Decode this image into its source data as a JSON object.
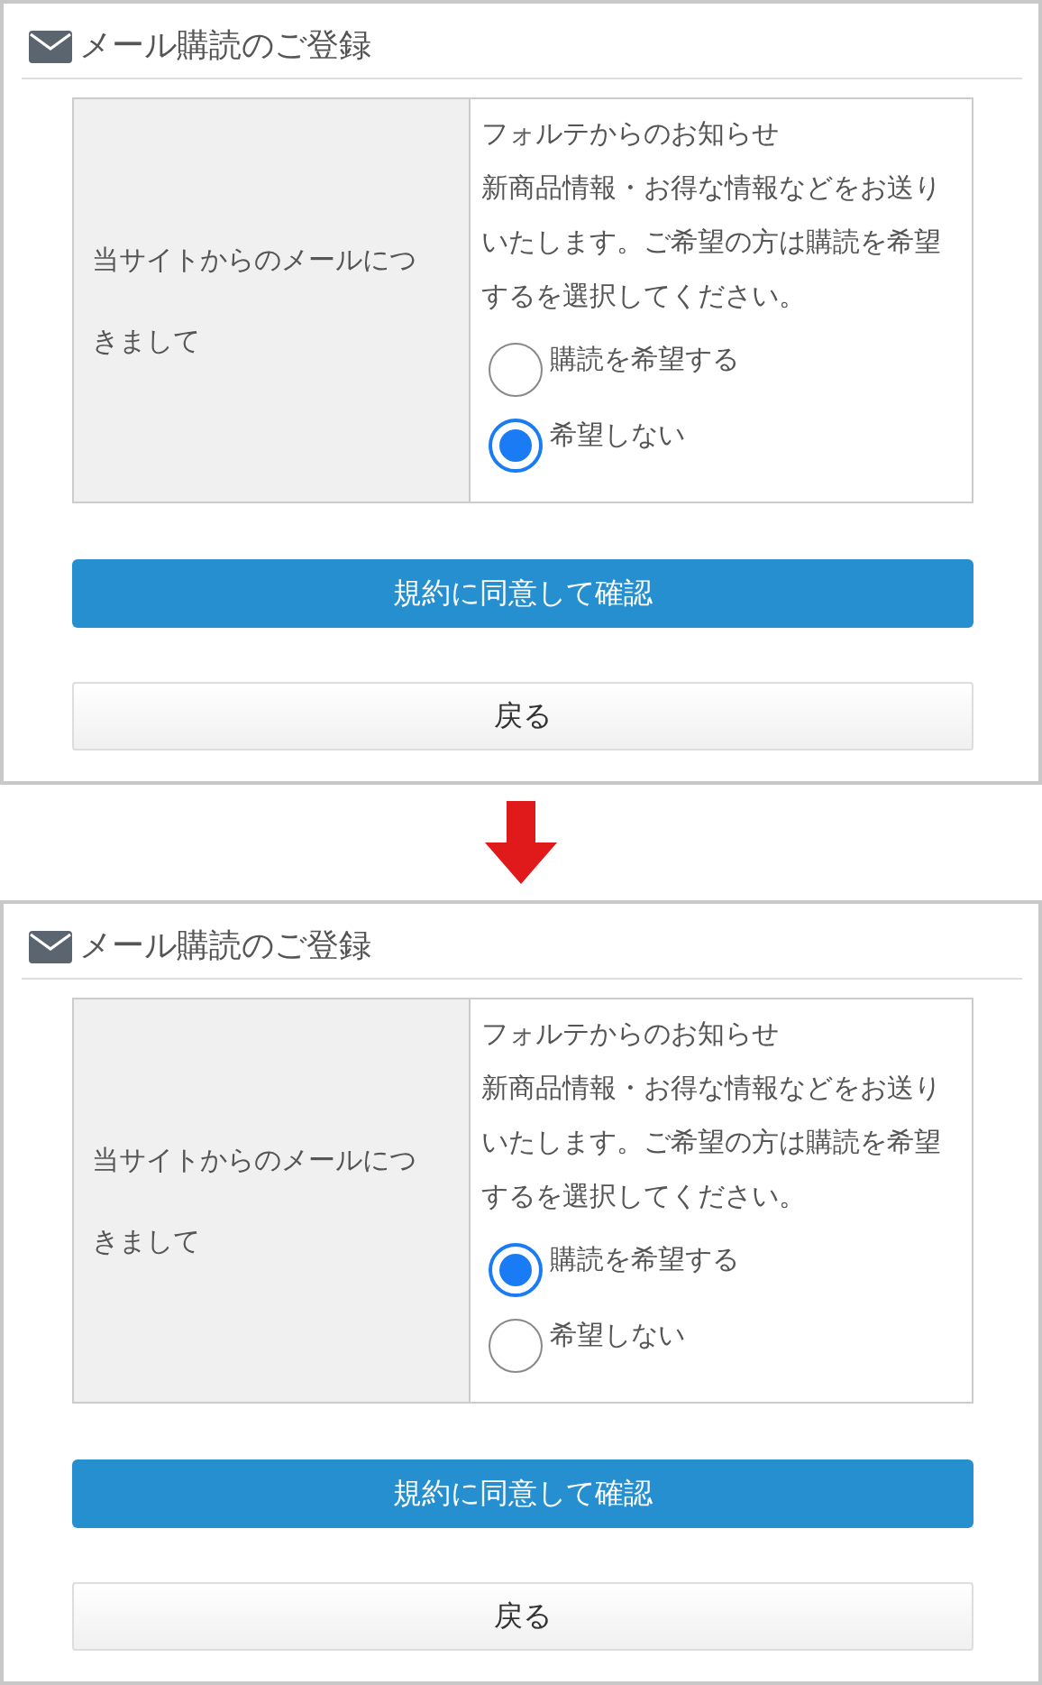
{
  "panels": [
    {
      "title": "メール購読のご登録",
      "field_label": "当サイトからのメールにつきまして",
      "intro": "フォルテからのお知らせ",
      "description": "新商品情報・お得な情報などをお送りいたします。ご希望の方は購読を希望するを選択してください。",
      "options": [
        {
          "label": "購読を希望する",
          "selected": false
        },
        {
          "label": "希望しない",
          "selected": true
        }
      ],
      "buttons": [
        {
          "label": "規約に同意して確認",
          "kind": "primary"
        },
        {
          "label": "戻る",
          "kind": "secondary"
        }
      ]
    },
    {
      "title": "メール購読のご登録",
      "field_label": "当サイトからのメールにつきまして",
      "intro": "フォルテからのお知らせ",
      "description": "新商品情報・お得な情報などをお送りいたします。ご希望の方は購読を希望するを選択してください。",
      "options": [
        {
          "label": "購読を希望する",
          "selected": true
        },
        {
          "label": "希望しない",
          "selected": false
        }
      ],
      "buttons": [
        {
          "label": "規約に同意して確認",
          "kind": "primary"
        },
        {
          "label": "戻る",
          "kind": "secondary"
        }
      ]
    }
  ]
}
